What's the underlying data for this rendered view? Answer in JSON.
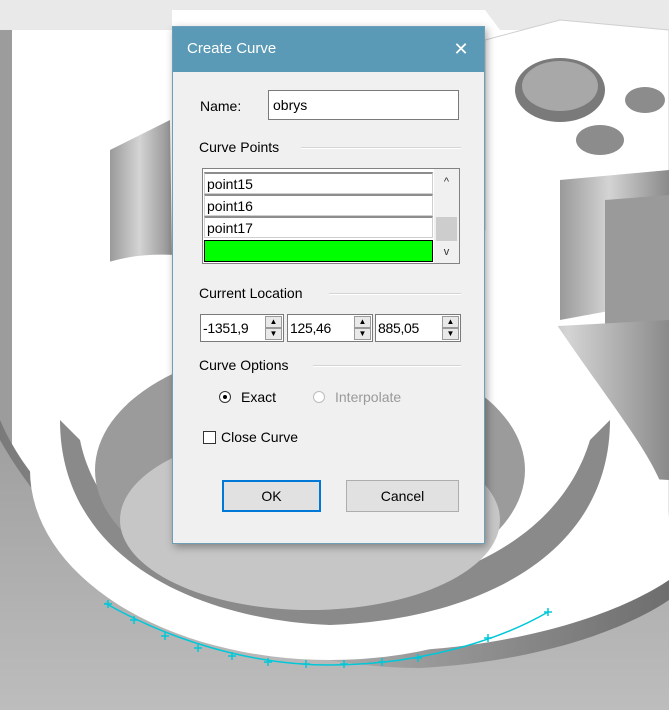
{
  "dialog": {
    "title": "Create Curve",
    "close_icon": "close-icon",
    "name_label": "Name:",
    "name_value": "obrys",
    "curve_points_label": "Curve Points",
    "points": [
      "point15",
      "point16",
      "point17",
      ""
    ],
    "selected_point_color": "#00ff00",
    "current_location_label": "Current Location",
    "location": {
      "x": "-1351,9",
      "y": "125,46",
      "z": "885,05"
    },
    "curve_options_label": "Curve Options",
    "option_exact": "Exact",
    "option_interpolate": "Interpolate",
    "selected_option": "Exact",
    "close_curve_label": "Close Curve",
    "close_curve_checked": false,
    "ok_label": "OK",
    "cancel_label": "Cancel"
  },
  "colors": {
    "titlebar": "#5a9ab6",
    "curve_markers": "#00c8d8",
    "model_gray": "#8c8c8c"
  }
}
